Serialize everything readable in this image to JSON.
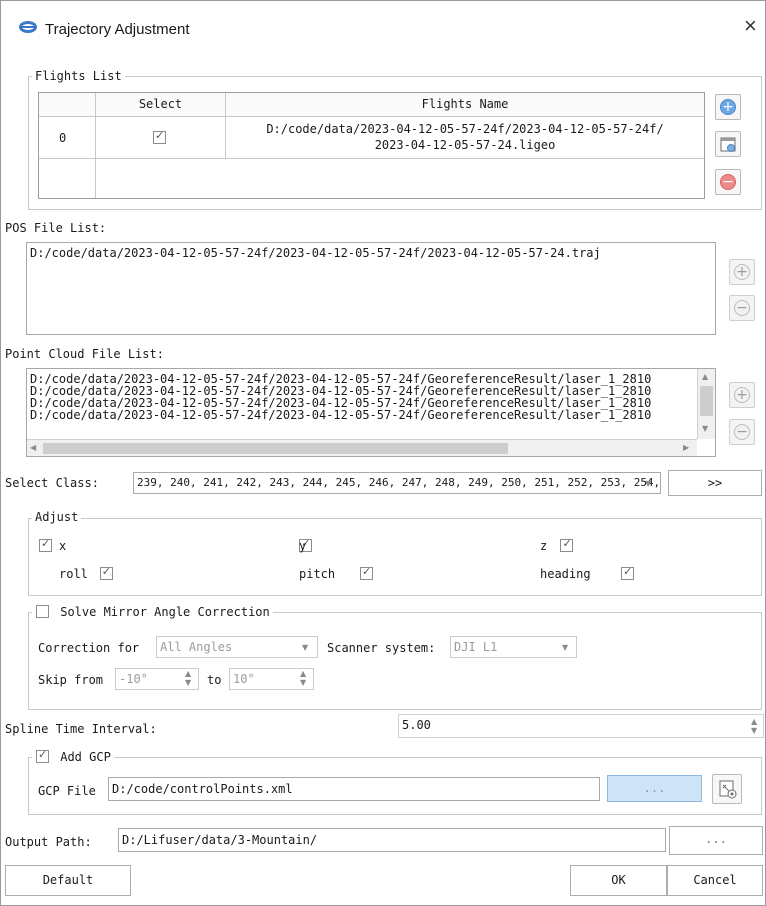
{
  "window": {
    "title": "Trajectory Adjustment",
    "close": "×",
    "icon": "app-logo-icon"
  },
  "flights": {
    "group_title": "Flights List",
    "columns": [
      "",
      "Select",
      "Flights Name"
    ],
    "rows": [
      {
        "index": "0",
        "selected": true,
        "name_line1": "D:/code/data/2023-04-12-05-57-24f/2023-04-12-05-57-24f/",
        "name_line2": "2023-04-12-05-57-24.ligeo"
      }
    ],
    "buttons": [
      "add-icon",
      "import-icon",
      "remove-icon"
    ]
  },
  "pos": {
    "label": "POS File List:",
    "files": [
      "D:/code/data/2023-04-12-05-57-24f/2023-04-12-05-57-24f/2023-04-12-05-57-24.traj"
    ]
  },
  "pointcloud": {
    "label": "Point Cloud File List:",
    "files": [
      "D:/code/data/2023-04-12-05-57-24f/2023-04-12-05-57-24f/GeoreferenceResult/laser_1_2810",
      "D:/code/data/2023-04-12-05-57-24f/2023-04-12-05-57-24f/GeoreferenceResult/laser_1_2810",
      "D:/code/data/2023-04-12-05-57-24f/2023-04-12-05-57-24f/GeoreferenceResult/laser_1_2810",
      "D:/code/data/2023-04-12-05-57-24f/2023-04-12-05-57-24f/GeoreferenceResult/laser_1_2810"
    ]
  },
  "select_class": {
    "label": "Select Class:",
    "value": "239, 240, 241, 242, 243, 244, 245, 246, 247, 248, 249, 250, 251, 252, 253, 254,",
    "button": ">>"
  },
  "adjust": {
    "group_title": "Adjust",
    "x": "x",
    "y": "y",
    "z": "z",
    "roll": "roll",
    "pitch": "pitch",
    "heading": "heading"
  },
  "mirror": {
    "title": "Solve Mirror Angle Correction",
    "checked": false,
    "correction_label": "Correction for",
    "correction_value": "All Angles",
    "scanner_label": "Scanner system:",
    "scanner_value": "DJI L1",
    "skip_label": "Skip from",
    "skip_from": "-10°",
    "to_label": "to",
    "skip_to": "10°"
  },
  "spline": {
    "label": "Spline Time Interval:",
    "value": "5.00"
  },
  "gcp": {
    "title": "Add GCP",
    "checked": true,
    "file_label": "GCP File",
    "file_value": "D:/code/controlPoints.xml",
    "browse": "..."
  },
  "output": {
    "label": "Output Path:",
    "value": "D:/Lifuser/data/3-Mountain/",
    "browse": "..."
  },
  "footer": {
    "default": "Default",
    "ok": "OK",
    "cancel": "Cancel"
  }
}
